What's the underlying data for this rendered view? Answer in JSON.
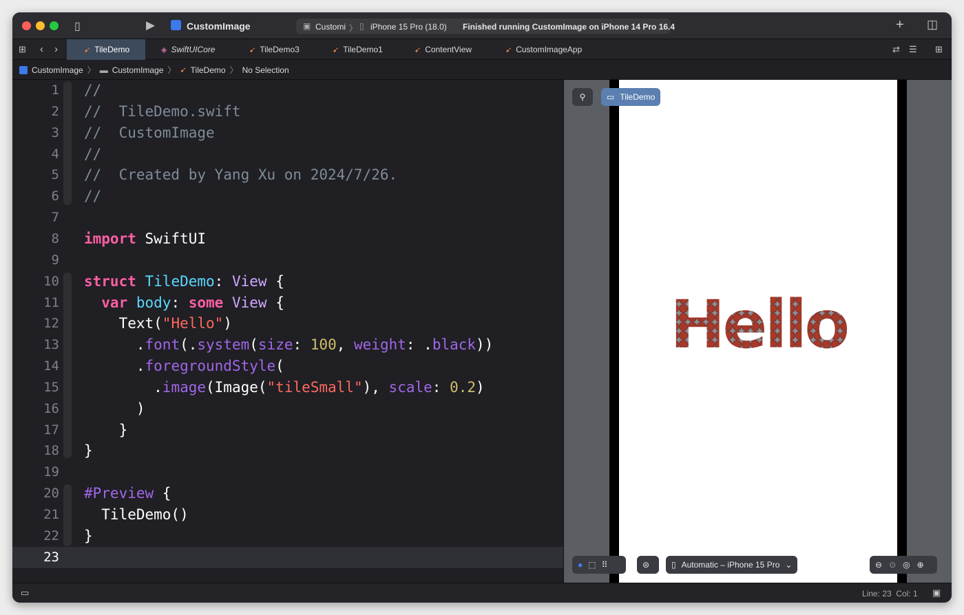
{
  "window": {
    "project": "CustomImage",
    "scheme": "Customi",
    "device": "iPhone 15 Pro (18.0)",
    "status": "Finished running CustomImage on iPhone 14 Pro 16.4"
  },
  "tabs": [
    {
      "label": "TileDemo",
      "active": true
    },
    {
      "label": "SwiftUICore"
    },
    {
      "label": "TileDemo3"
    },
    {
      "label": "TileDemo1"
    },
    {
      "label": "ContentView"
    },
    {
      "label": "CustomImageApp"
    }
  ],
  "breadcrumb": [
    "CustomImage",
    "CustomImage",
    "TileDemo",
    "No Selection"
  ],
  "code": [
    [
      [
        "//",
        "comment"
      ]
    ],
    [
      [
        "//  TileDemo.swift",
        "comment"
      ]
    ],
    [
      [
        "//  CustomImage",
        "comment"
      ]
    ],
    [
      [
        "//",
        "comment"
      ]
    ],
    [
      [
        "//  Created by Yang Xu on 2024/7/26.",
        "comment"
      ]
    ],
    [
      [
        "//",
        "comment"
      ]
    ],
    [],
    [
      [
        "import",
        "kw"
      ],
      [
        " SwiftUI",
        "plain"
      ]
    ],
    [],
    [
      [
        "struct",
        "kw"
      ],
      [
        " ",
        "plain"
      ],
      [
        "TileDemo",
        "decl"
      ],
      [
        ": ",
        "plain"
      ],
      [
        "View",
        "type"
      ],
      [
        " {",
        "plain"
      ]
    ],
    [
      [
        "  var",
        "kw"
      ],
      [
        " ",
        "plain"
      ],
      [
        "body",
        "decl"
      ],
      [
        ": ",
        "plain"
      ],
      [
        "some",
        "kw"
      ],
      [
        " ",
        "plain"
      ],
      [
        "View",
        "type"
      ],
      [
        " {",
        "plain"
      ]
    ],
    [
      [
        "    Text(",
        "plain"
      ],
      [
        "\"Hello\"",
        "str"
      ],
      [
        ")",
        "plain"
      ]
    ],
    [
      [
        "      .",
        "plain"
      ],
      [
        "font",
        "fn"
      ],
      [
        "(.",
        "plain"
      ],
      [
        "system",
        "fn"
      ],
      [
        "(",
        "plain"
      ],
      [
        "size",
        "fn"
      ],
      [
        ": ",
        "plain"
      ],
      [
        "100",
        "num"
      ],
      [
        ", ",
        "plain"
      ],
      [
        "weight",
        "fn"
      ],
      [
        ": .",
        "plain"
      ],
      [
        "black",
        "fn"
      ],
      [
        "))",
        "plain"
      ]
    ],
    [
      [
        "      .",
        "plain"
      ],
      [
        "foregroundStyle",
        "fn"
      ],
      [
        "(",
        "plain"
      ]
    ],
    [
      [
        "        .",
        "plain"
      ],
      [
        "image",
        "fn"
      ],
      [
        "(Image(",
        "plain"
      ],
      [
        "\"tileSmall\"",
        "str"
      ],
      [
        "), ",
        "plain"
      ],
      [
        "scale",
        "fn"
      ],
      [
        ": ",
        "plain"
      ],
      [
        "0.2",
        "num"
      ],
      [
        ")",
        "plain"
      ]
    ],
    [
      [
        "      )",
        "plain"
      ]
    ],
    [
      [
        "    }",
        "plain"
      ]
    ],
    [
      [
        "}",
        "plain"
      ]
    ],
    [],
    [
      [
        "#Preview",
        "fn"
      ],
      [
        " {",
        "plain"
      ]
    ],
    [
      [
        "  TileDemo()",
        "plain"
      ]
    ],
    [
      [
        "}",
        "plain"
      ]
    ],
    []
  ],
  "current_line": 23,
  "preview": {
    "pin_label": "TileDemo",
    "text": "Hello",
    "device_picker": "Automatic – iPhone 15 Pro"
  },
  "statusbar": {
    "position": "Line: 23  Col: 1"
  }
}
